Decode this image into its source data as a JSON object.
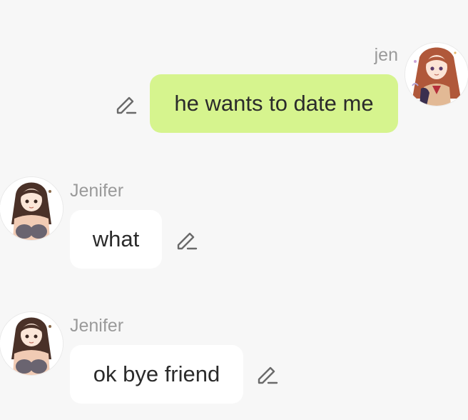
{
  "messages": [
    {
      "sender": "jen",
      "text": "he wants to date me",
      "direction": "outgoing",
      "avatar_icon": "anime-girl-red-hair-avatar",
      "edit_icon": "pencil-edit-icon"
    },
    {
      "sender": "Jenifer",
      "text": "what",
      "direction": "incoming",
      "avatar_icon": "anime-girl-brown-hair-avatar",
      "edit_icon": "pencil-edit-icon"
    },
    {
      "sender": "Jenifer",
      "text": "ok bye friend",
      "direction": "incoming",
      "avatar_icon": "anime-girl-brown-hair-avatar",
      "edit_icon": "pencil-edit-icon"
    }
  ],
  "colors": {
    "background": "#f7f7f7",
    "outgoing_bubble": "#d6f48e",
    "incoming_bubble": "#ffffff",
    "sender_name": "#9a9a9a",
    "message_text": "#2b2b2b",
    "icon_stroke": "#6a6a6a"
  }
}
